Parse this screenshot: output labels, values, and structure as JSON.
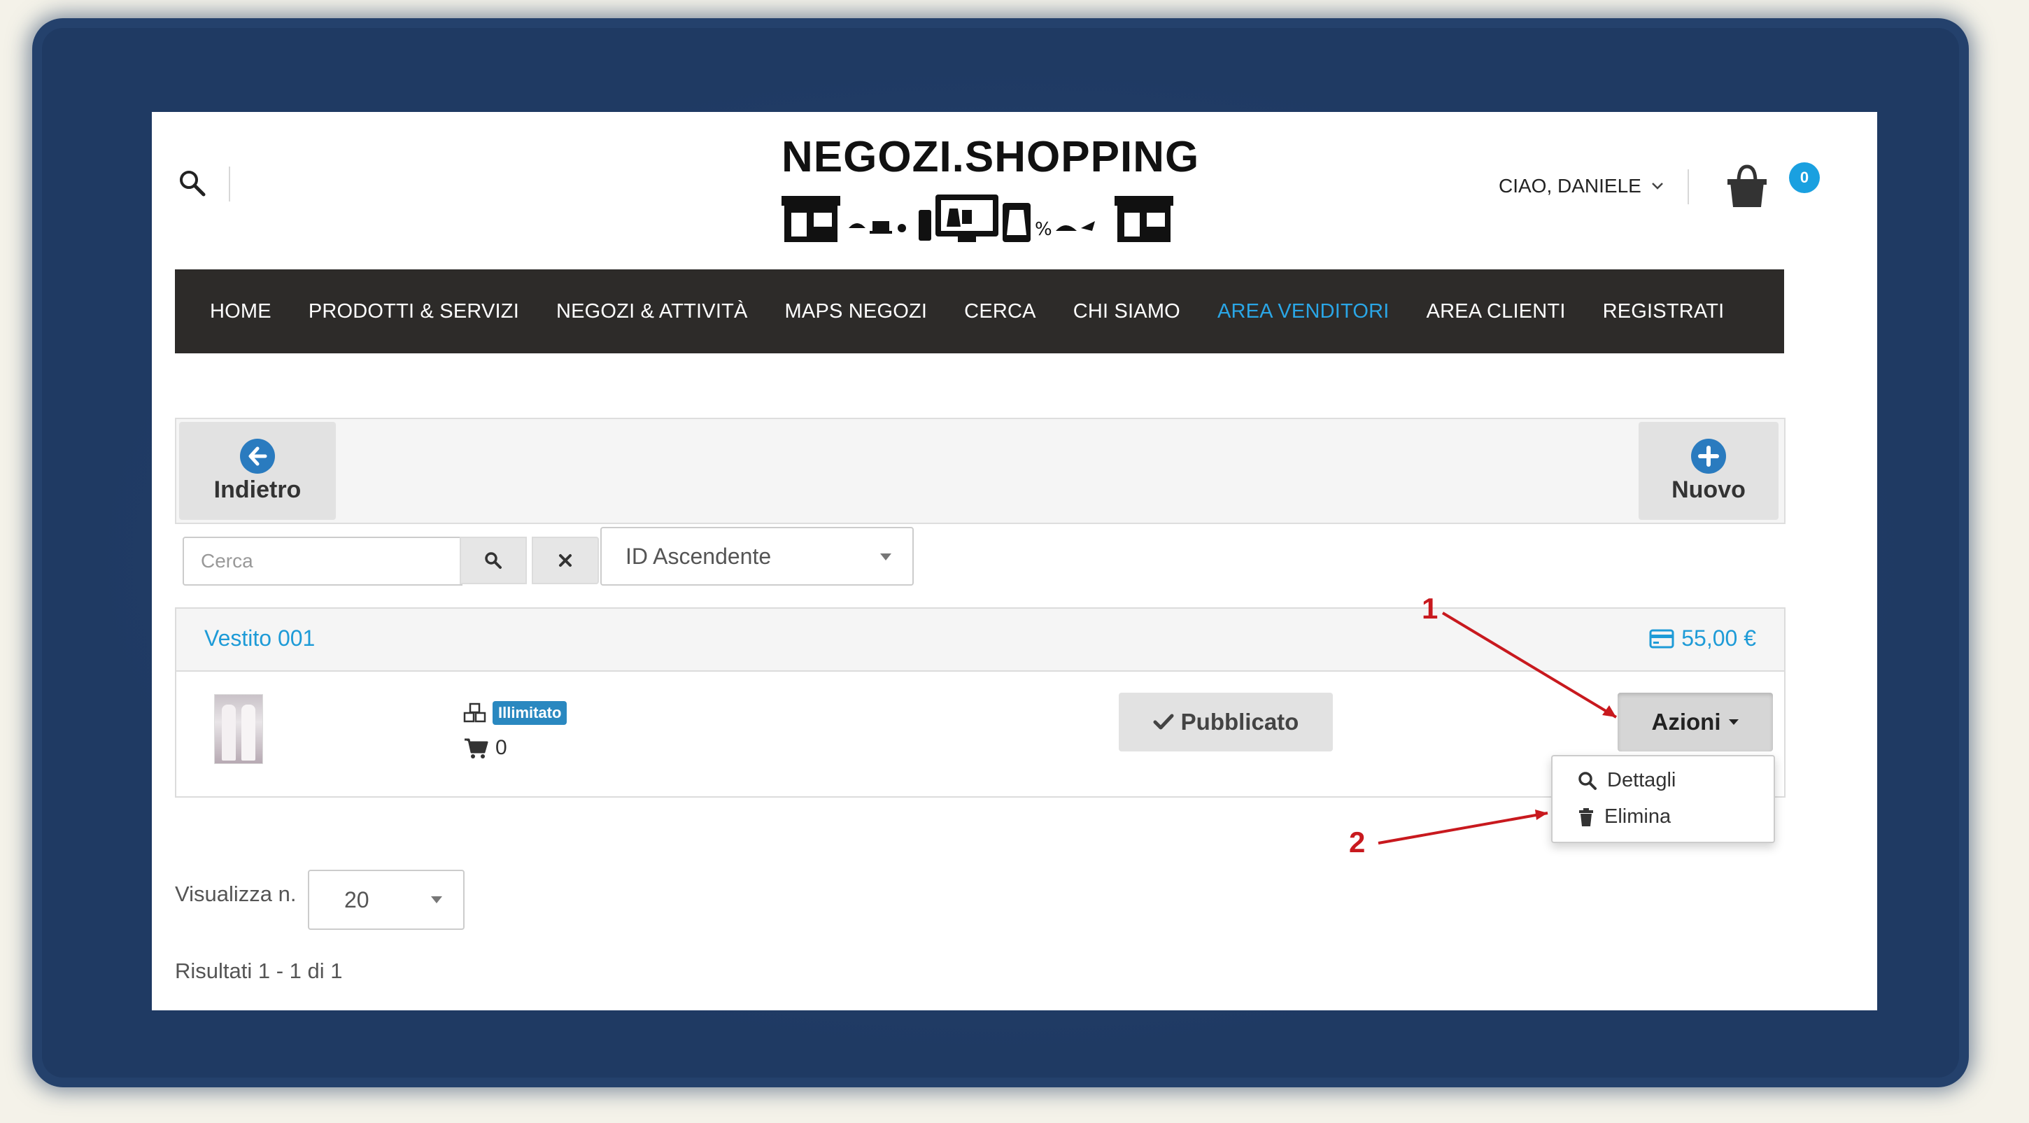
{
  "header": {
    "logo_text": "NEGOZI.SHOPPING",
    "user_greeting": "CIAO, DANIELE",
    "cart_count": "0"
  },
  "nav": {
    "items": [
      {
        "label": "HOME"
      },
      {
        "label": "PRODOTTI & SERVIZI"
      },
      {
        "label": "NEGOZI & ATTIVITÀ"
      },
      {
        "label": "MAPS NEGOZI"
      },
      {
        "label": "CERCA"
      },
      {
        "label": "CHI SIAMO"
      },
      {
        "label": "AREA VENDITORI",
        "active": true
      },
      {
        "label": "AREA CLIENTI"
      },
      {
        "label": "REGISTRATI"
      }
    ],
    "active_color": "#2aa6e6",
    "bar_color": "#2d2b29"
  },
  "toolbar": {
    "back_label": "Indietro",
    "new_label": "Nuovo"
  },
  "filter": {
    "search_placeholder": "Cerca",
    "sort_value": "ID Ascendente"
  },
  "product": {
    "title": "Vestito 001",
    "price": "55,00 €",
    "stock_badge": "Illimitato",
    "sold_count": "0",
    "status_button": "Pubblicato",
    "actions_button": "Azioni"
  },
  "actions_menu": {
    "items": [
      {
        "label": "Dettagli",
        "icon": "search-icon"
      },
      {
        "label": "Elimina",
        "icon": "trash-icon"
      }
    ]
  },
  "footer": {
    "view_label": "Visualizza n.",
    "view_value": "20",
    "results_text": "Risultati 1 - 1 di 1"
  },
  "annotations": {
    "label_1": "1",
    "label_2": "2",
    "color": "#c8191e"
  }
}
